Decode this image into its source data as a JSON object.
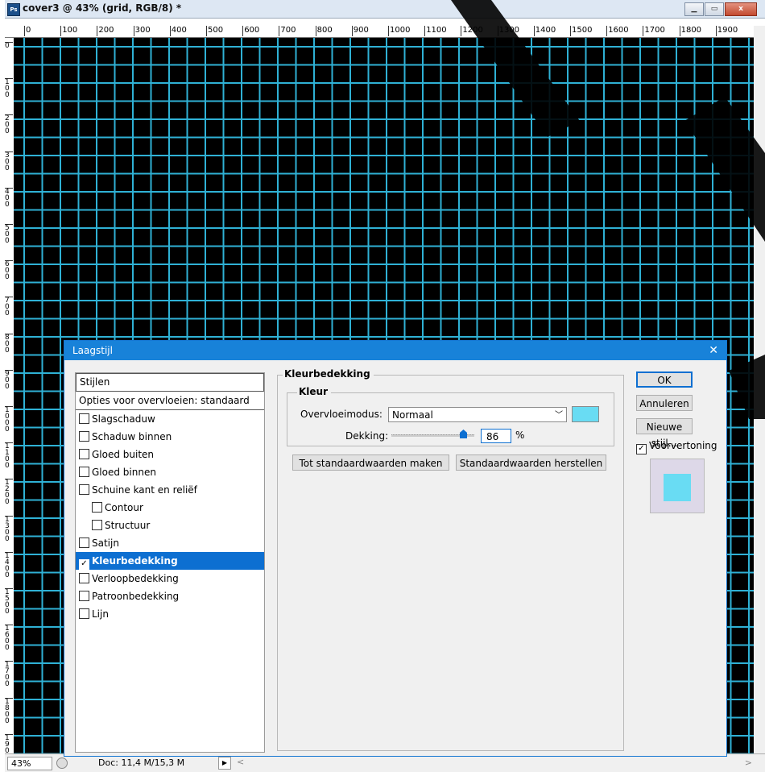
{
  "window": {
    "app_icon": "Ps",
    "title": "cover3 @ 43% (grid, RGB/8) *",
    "buttons": [
      "minimize",
      "maximize",
      "close"
    ],
    "close_label": "x"
  },
  "ruler": {
    "top_labels": [
      "0",
      "100",
      "200",
      "300",
      "400",
      "500",
      "600",
      "700",
      "800",
      "900",
      "1000",
      "1100",
      "1200",
      "1300",
      "1400",
      "1500",
      "1600",
      "1700",
      "1800",
      "1900"
    ],
    "left_labels": [
      "0",
      "1\n0\n0",
      "2\n0\n0",
      "3\n0\n0",
      "4\n0\n0",
      "5\n0\n0",
      "6\n0\n0",
      "7\n0\n0",
      "8\n0\n0",
      "9\n0\n0",
      "1\n0\n0\n0",
      "1\n1\n0\n0",
      "1\n2\n0\n0",
      "1\n3\n0\n0",
      "1\n4\n0\n0",
      "1\n5\n0\n0",
      "1\n6\n0\n0",
      "1\n7\n0\n0",
      "1\n8\n0\n0",
      "1\n9\n0\n0"
    ]
  },
  "canvas": {
    "grid_color": "#2fb1d5",
    "background": "#000000"
  },
  "status": {
    "zoom": "43%",
    "doc_info": "Doc: 11,4 M/15,3 M",
    "arrow": "▶",
    "scroll_left": "<",
    "scroll_right": ">"
  },
  "dialog": {
    "title": "Laagstijl",
    "close": "✕",
    "styles_header": "Stijlen",
    "blend_options": "Opties voor overvloeien: standaard",
    "items": [
      {
        "label": "Slagschaduw",
        "checked": false,
        "sub": false,
        "selected": false
      },
      {
        "label": "Schaduw binnen",
        "checked": false,
        "sub": false,
        "selected": false
      },
      {
        "label": "Gloed buiten",
        "checked": false,
        "sub": false,
        "selected": false
      },
      {
        "label": "Gloed binnen",
        "checked": false,
        "sub": false,
        "selected": false
      },
      {
        "label": "Schuine kant en reliëf",
        "checked": false,
        "sub": false,
        "selected": false
      },
      {
        "label": "Contour",
        "checked": false,
        "sub": true,
        "selected": false
      },
      {
        "label": "Structuur",
        "checked": false,
        "sub": true,
        "selected": false
      },
      {
        "label": "Satijn",
        "checked": false,
        "sub": false,
        "selected": false
      },
      {
        "label": "Kleurbedekking",
        "checked": true,
        "sub": false,
        "selected": true
      },
      {
        "label": "Verloopbedekking",
        "checked": false,
        "sub": false,
        "selected": false
      },
      {
        "label": "Patroonbedekking",
        "checked": false,
        "sub": false,
        "selected": false
      },
      {
        "label": "Lijn",
        "checked": false,
        "sub": false,
        "selected": false
      }
    ],
    "overlay": {
      "group_title": "Kleurbedekking",
      "color_group_title": "Kleur",
      "blend_mode_label": "Overvloeimodus:",
      "blend_mode_value": "Normaal",
      "color_swatch": "#69dcf3",
      "opacity_label": "Dekking:",
      "opacity_value": "86",
      "opacity_fraction": 0.86,
      "opacity_unit": "%",
      "make_default": "Tot standaardwaarden maken",
      "reset_default": "Standaardwaarden herstellen"
    },
    "buttons": {
      "ok": "OK",
      "cancel": "Annuleren",
      "new_style": "Nieuwe stijl..."
    },
    "preview_label": "Voorvertoning",
    "preview_checked": true,
    "preview_color": "#69dcf3"
  }
}
